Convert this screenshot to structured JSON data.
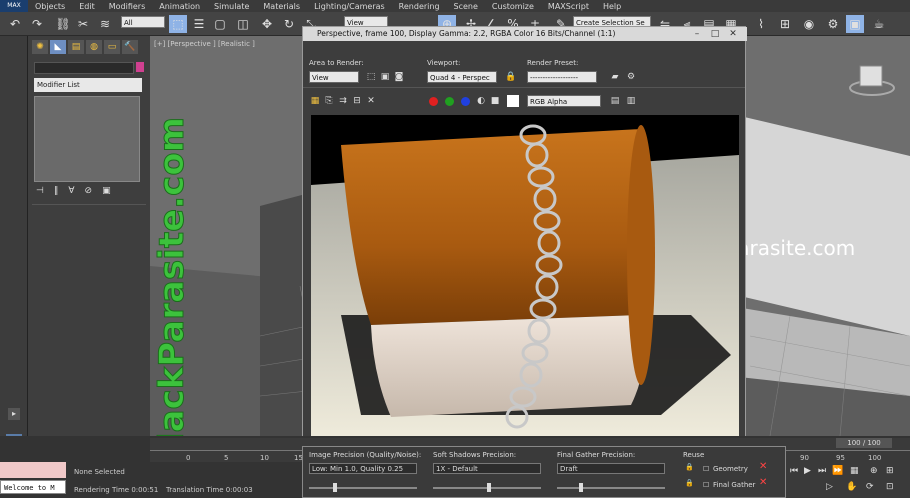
{
  "menu": [
    "Objects",
    "Edit",
    "Modifiers",
    "Animation",
    "Simulate",
    "Materials",
    "Lighting/Cameras",
    "Rendering",
    "Scene",
    "Customize",
    "MAXScript",
    "Help"
  ],
  "app_logo": "MAX",
  "toolbar": {
    "filter_value": "All",
    "coord_value": "View",
    "selection_set": "Create Selection Se"
  },
  "command_panel": {
    "modifier_list": "Modifier List"
  },
  "viewport": {
    "label": "[+] [Perspective ] [Realistic ]"
  },
  "watermark": {
    "vertical": "BlackParasite.com",
    "horizontal": "BlackParasite.com"
  },
  "render_window": {
    "title": "Perspective, frame 100, Display Gamma: 2.2, RGBA Color 16 Bits/Channel (1:1)",
    "area_label": "Area to Render:",
    "area_value": "View",
    "viewport_label": "Viewport:",
    "viewport_value": "Quad 4 - Perspec",
    "preset_label": "Render Preset:",
    "preset_value": "-------------------",
    "channel_value": "RGB Alpha"
  },
  "timeline": {
    "frame_counter": "100 / 100",
    "ticks": [
      "0",
      "5",
      "10",
      "15",
      "90",
      "95",
      "100"
    ]
  },
  "status": {
    "welcome": "Welcome to M",
    "none_selected": "None Selected",
    "rendering_time": "Rendering Time  0:00:51",
    "translation_time": "Translation Time  0:00:03"
  },
  "precision": {
    "image_label": "Image Precision (Quality/Noise):",
    "image_value": "Low: Min 1.0, Quality 0.25",
    "shadows_label": "Soft Shadows Precision:",
    "shadows_value": "1X - Default",
    "gather_label": "Final Gather Precision:",
    "gather_value": "Draft",
    "reuse_label": "Reuse",
    "geometry_label": "Geometry",
    "final_gather_label": "Final Gather"
  },
  "colors": {
    "accent_watermark": "#3cc23c",
    "render_cylinder": "#b8641a"
  }
}
